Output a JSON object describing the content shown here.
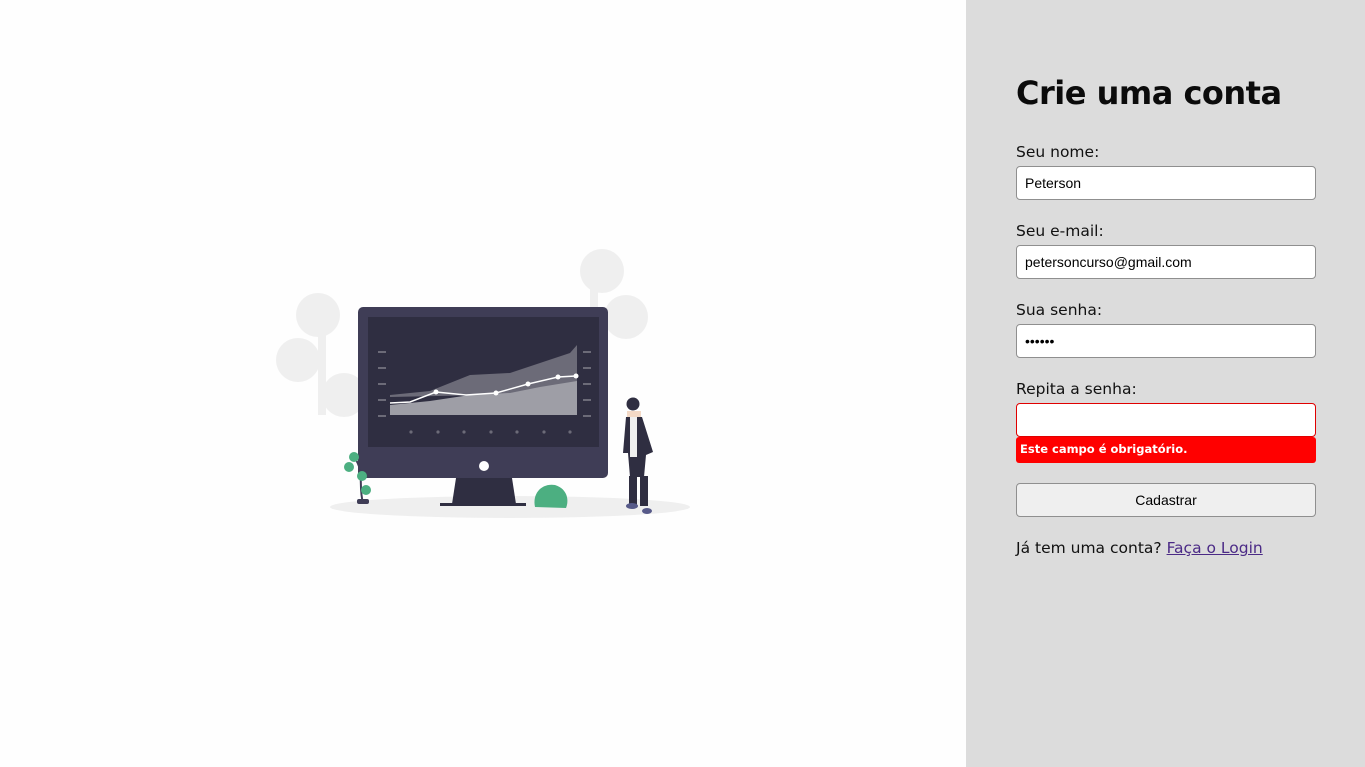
{
  "form": {
    "title": "Crie uma conta",
    "name_label": "Seu nome:",
    "name_value": "Peterson",
    "email_label": "Seu e-mail:",
    "email_value": "petersoncurso@gmail.com",
    "password_label": "Sua senha:",
    "password_value": "123456",
    "repeat_label": "Repita a senha:",
    "repeat_value": "",
    "error_message": "Este campo é obrigatório.",
    "submit_label": "Cadastrar",
    "login_prompt": "Já tem uma conta?",
    "login_link": "Faça o Login"
  },
  "colors": {
    "right_panel": "#dcdcdc",
    "error": "#ff0000",
    "link": "#4b2a86",
    "monitor": "#3f3d56",
    "plant": "#4caf81"
  },
  "icons": [
    "analytics-dashboard-illustration"
  ]
}
